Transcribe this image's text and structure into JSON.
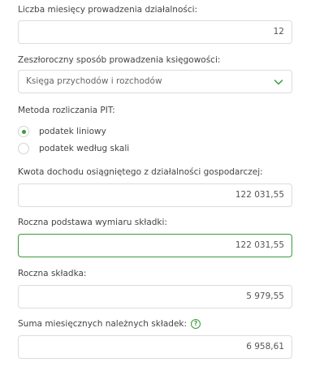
{
  "months": {
    "label": "Liczba miesięcy prowadzenia działalności:",
    "value": "12"
  },
  "bookkeeping": {
    "label": "Zeszłoroczny sposób prowadzenia księgowości:",
    "selected": "Księga przychodów i rozchodów",
    "icon": "chevron-down-icon"
  },
  "pit": {
    "label": "Metoda rozliczania PIT:",
    "options": [
      {
        "label": "podatek liniowy",
        "checked": true
      },
      {
        "label": "podatek według skali",
        "checked": false
      }
    ]
  },
  "income": {
    "label": "Kwota dochodu osiągniętego z działalności gospodarczej:",
    "value": "122 031,55"
  },
  "base": {
    "label": "Roczna podstawa wymiaru składki:",
    "value": "122 031,55"
  },
  "annual": {
    "label": "Roczna składka:",
    "value": "5 979,55"
  },
  "monthly_sum": {
    "label": "Suma miesięcznych należnych składek:",
    "help_icon": "question-circle-icon",
    "value": "6 958,61"
  },
  "colors": {
    "accent": "#3a9a3a",
    "border": "#dcdcdc"
  }
}
